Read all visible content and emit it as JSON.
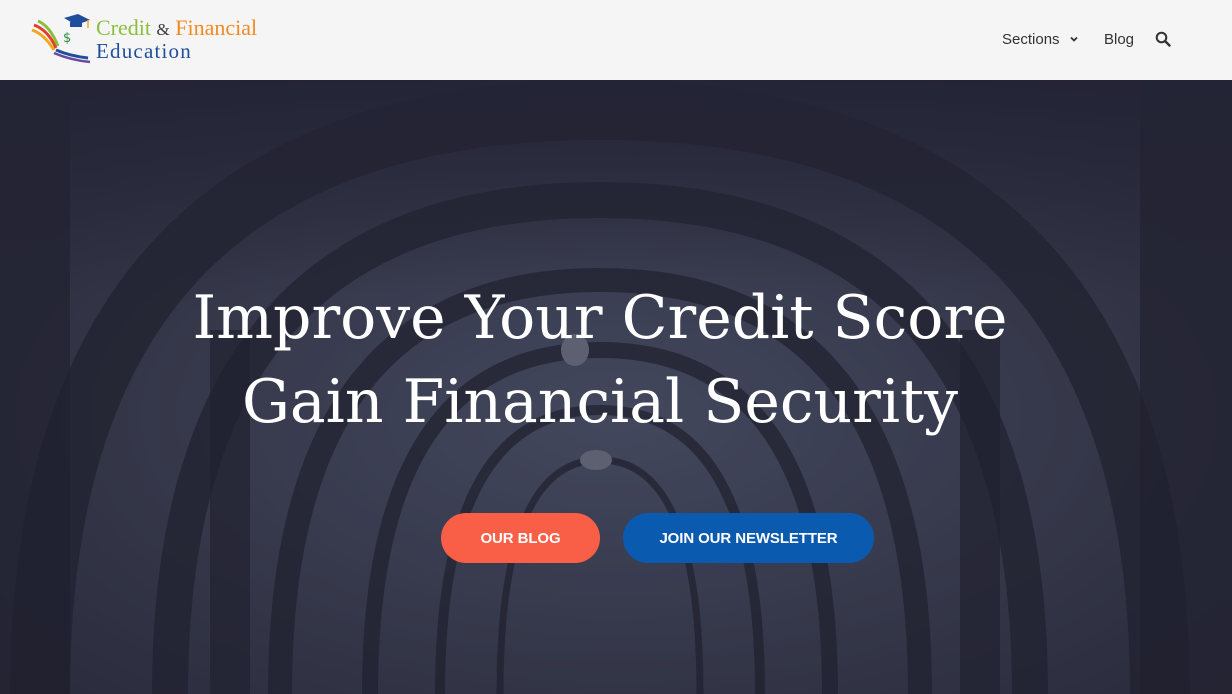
{
  "logo": {
    "credit": "Credit",
    "amp": "&",
    "financial": "Financial",
    "education": "Education"
  },
  "nav": {
    "sections": "Sections",
    "blog": "Blog"
  },
  "icons": {
    "nav_sections": "chevron-down-icon",
    "search": "search-icon"
  },
  "hero": {
    "title_line1": "Improve Your Credit Score",
    "title_line2": "Gain Financial Security"
  },
  "buttons": {
    "our_blog": "OUR BLOG",
    "newsletter": "JOIN OUR NEWSLETTER"
  },
  "colors": {
    "header_bg": "#f5f5f5",
    "hero_overlay": "#2e3142",
    "btn_blog": "#f95f46",
    "btn_newsletter": "#0a5bb0"
  }
}
